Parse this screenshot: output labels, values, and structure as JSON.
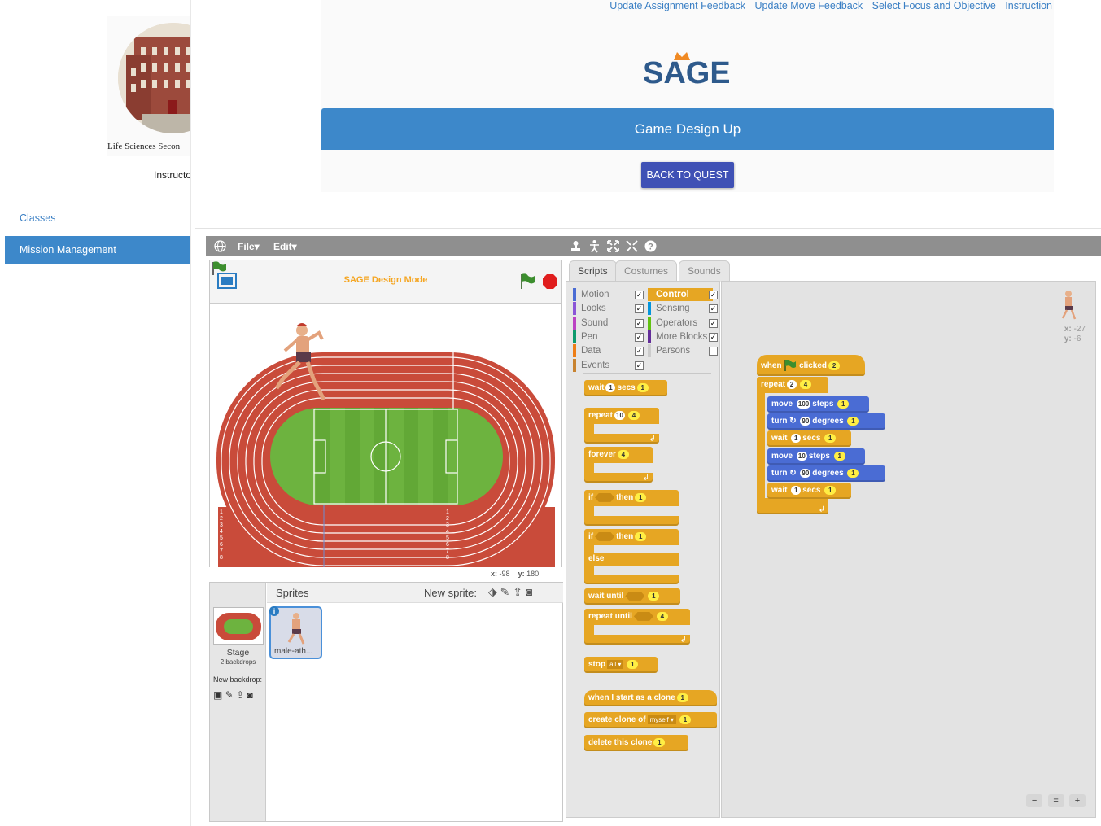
{
  "sidebar": {
    "school_name": "Life Sciences Secon",
    "role": "Instructo",
    "nav": [
      "Classes",
      "Mission Management"
    ]
  },
  "header": {
    "links": [
      "Update Assignment Feedback",
      "Update Move Feedback",
      "Select Focus and Objective",
      "Instruction"
    ],
    "brand": "SAGE",
    "title": "Game Design Up",
    "back_button": "BACK TO QUEST"
  },
  "snap": {
    "menu": {
      "file": "File▾",
      "edit": "Edit▾"
    },
    "stage_title": "SAGE Design Mode",
    "coords": {
      "x_label": "x:",
      "x_value": "-98",
      "y_label": "y:",
      "y_value": "180"
    },
    "tabs": [
      "Scripts",
      "Costumes",
      "Sounds"
    ],
    "categories": [
      {
        "label": "Motion",
        "color": "#4a6cd4",
        "active": false,
        "checked": true
      },
      {
        "label": "Looks",
        "color": "#8a55d7",
        "active": false,
        "checked": true
      },
      {
        "label": "Sound",
        "color": "#bb42c3",
        "active": false,
        "checked": true
      },
      {
        "label": "Pen",
        "color": "#0e9a6c",
        "active": false,
        "checked": true
      },
      {
        "label": "Data",
        "color": "#ee7d16",
        "active": false,
        "checked": true
      },
      {
        "label": "Events",
        "color": "#c88330",
        "active": false,
        "checked": true
      },
      {
        "label": "Control",
        "color": "#e6a623",
        "active": true,
        "checked": true
      },
      {
        "label": "Sensing",
        "color": "#0494dc",
        "active": false,
        "checked": true
      },
      {
        "label": "Operators",
        "color": "#62c213",
        "active": false,
        "checked": true
      },
      {
        "label": "More Blocks",
        "color": "#632d99",
        "active": false,
        "checked": true
      },
      {
        "label": "Parsons",
        "color": "#cccccc",
        "active": false,
        "checked": false
      }
    ],
    "palette": {
      "wait": {
        "label": "wait",
        "n": "1",
        "unit": "secs",
        "pts": "1"
      },
      "repeat": {
        "label": "repeat",
        "n": "10",
        "pts": "4"
      },
      "forever": {
        "label": "forever",
        "pts": "4"
      },
      "if_then": {
        "label": "if",
        "then": "then",
        "pts": "1"
      },
      "if_else": {
        "label": "if",
        "then": "then",
        "else": "else",
        "pts": "1"
      },
      "wait_until": {
        "label": "wait until",
        "pts": "1"
      },
      "repeat_until": {
        "label": "repeat until",
        "pts": "4"
      },
      "stop": {
        "label": "stop",
        "opt": "all",
        "pts": "1"
      },
      "clone_start": {
        "label": "when I start as a clone",
        "pts": "1"
      },
      "create_clone": {
        "label": "create clone of",
        "opt": "myself",
        "pts": "1"
      },
      "delete_clone": {
        "label": "delete this clone",
        "pts": "1"
      }
    },
    "script": {
      "hat": {
        "when": "when",
        "clicked": "clicked",
        "pts": "2"
      },
      "repeat": {
        "label": "repeat",
        "n": "2",
        "pts": "4"
      },
      "body": [
        {
          "kind": "mot",
          "a": "move",
          "n": "100",
          "b": "steps",
          "pts": "1"
        },
        {
          "kind": "mot",
          "a": "turn ↻",
          "n": "90",
          "b": "degrees",
          "pts": "1"
        },
        {
          "kind": "ctrl",
          "a": "wait",
          "n": "1",
          "b": "secs",
          "pts": "1"
        },
        {
          "kind": "mot",
          "a": "move",
          "n": "10",
          "b": "steps",
          "pts": "1"
        },
        {
          "kind": "mot",
          "a": "turn ↻",
          "n": "90",
          "b": "degrees",
          "pts": "1"
        },
        {
          "kind": "ctrl",
          "a": "wait",
          "n": "1",
          "b": "secs",
          "pts": "1"
        }
      ]
    },
    "sprite_pos": {
      "x_label": "x:",
      "x": "-27",
      "y_label": "y:",
      "y": "-6"
    },
    "corral": {
      "title": "Sprites",
      "new_sprite": "New sprite:",
      "stage_label": "Stage",
      "backdrops": "2 backdrops",
      "new_backdrop": "New backdrop:",
      "sprite_name": "male-ath..."
    },
    "zoom": [
      "−",
      "=",
      "+"
    ]
  },
  "colors": {
    "accent": "#3d88ca",
    "button": "#3f51b5",
    "control": "#e6a623",
    "motion": "#4a6cd4",
    "track": "#c94b3a",
    "field": "#6db33f"
  }
}
